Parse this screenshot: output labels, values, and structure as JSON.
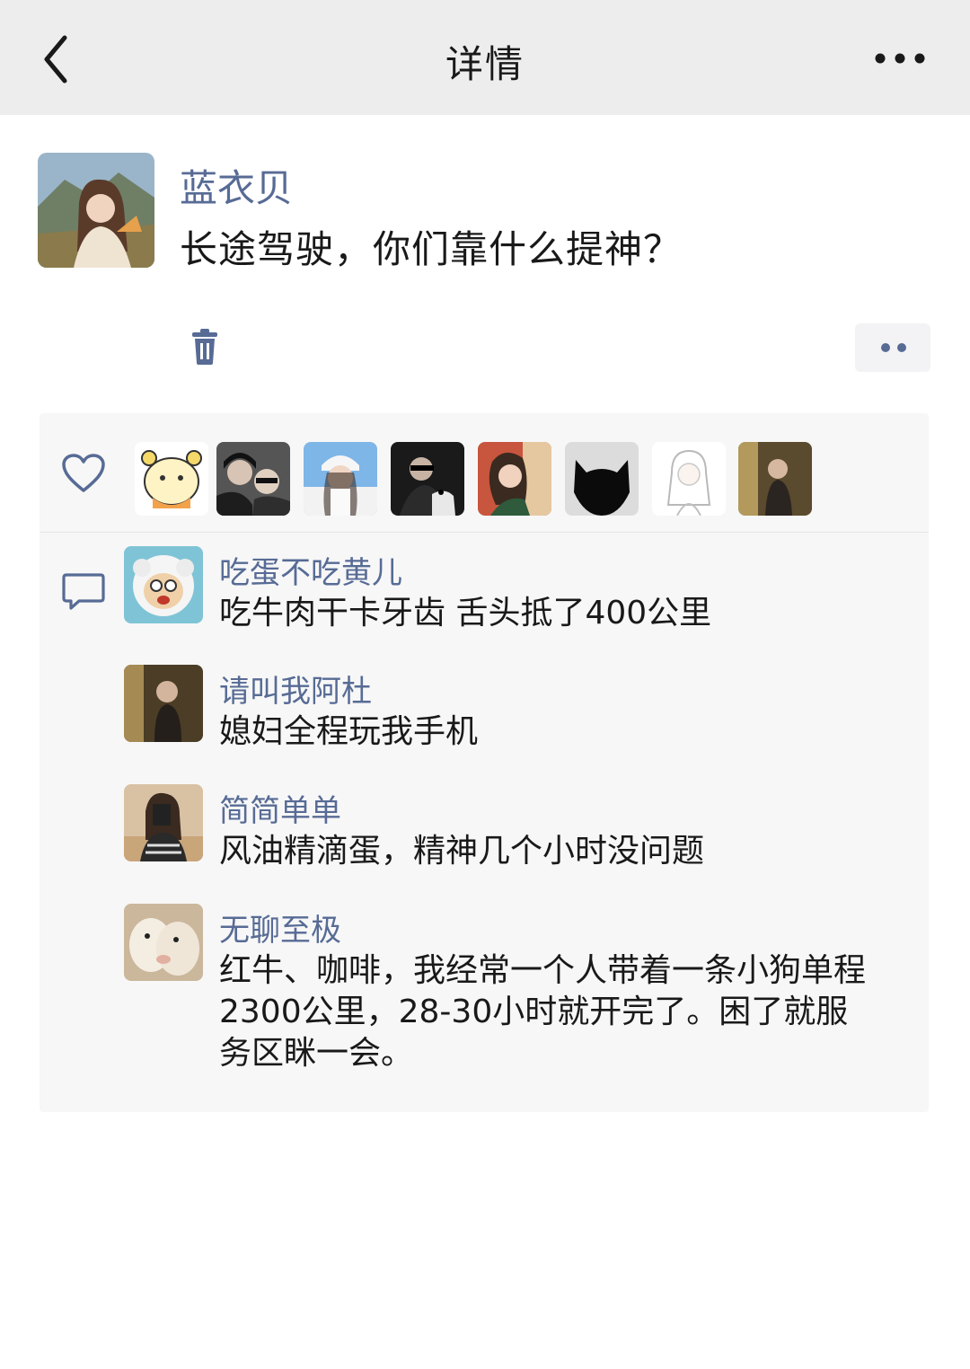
{
  "nav": {
    "title": "详情",
    "back_icon": "chevron-left-icon",
    "more_icon": "ellipsis-icon"
  },
  "post": {
    "author": "蓝衣贝",
    "content": "长途驾驶，你们靠什么提神？",
    "delete_icon": "trash-icon",
    "action_icon": "two-dots-icon"
  },
  "likes": {
    "icon": "heart-icon",
    "count_avatars": 8
  },
  "comments": [
    {
      "name": "吃蛋不吃黄儿",
      "text": "吃牛肉干卡牙齿 舌头抵了400公里"
    },
    {
      "name": "请叫我阿杜",
      "text": "媳妇全程玩我手机"
    },
    {
      "name": "简简单单",
      "text": "风油精滴蛋，精神几个小时没问题"
    },
    {
      "name": "无聊至极",
      "text": "红牛、咖啡，我经常一个人带着一条小狗单程2300公里，28-30小时就开完了。困了就服务区眯一会。"
    }
  ],
  "colors": {
    "nav_bg": "#ededed",
    "name_blue": "#576b95",
    "text": "#191919",
    "interaction_bg": "#f7f7f7"
  }
}
